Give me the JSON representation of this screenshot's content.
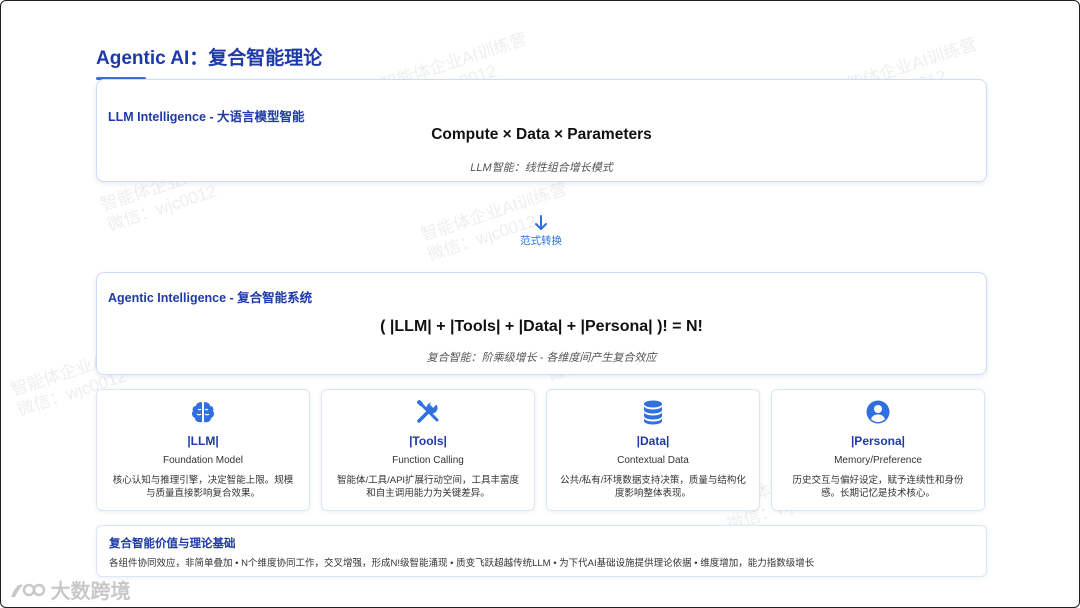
{
  "title": "Agentic AI：复合智能理论",
  "llm_card": {
    "heading": "LLM Intelligence - 大语言模型智能",
    "formula": "Compute × Data × Parameters",
    "caption": "LLM智能：线性组合增长模式"
  },
  "transition": {
    "label": "范式转换",
    "icon": "arrow-down-icon"
  },
  "agentic_card": {
    "heading": "Agentic Intelligence - 复合智能系统",
    "formula": "( |LLM| + |Tools| + |Data| + |Persona| )! = N!",
    "caption": "复合智能：阶乘级增长 - 各维度间产生复合效应"
  },
  "features": [
    {
      "icon": "brain-icon",
      "name": "|LLM|",
      "subtitle": "Foundation Model",
      "description": "核心认知与推理引擎，决定智能上限。规模与质量直接影响复合效果。"
    },
    {
      "icon": "tools-icon",
      "name": "|Tools|",
      "subtitle": "Function Calling",
      "description": "智能体/工具/API扩展行动空间，工具丰富度和自主调用能力为关键差异。"
    },
    {
      "icon": "database-icon",
      "name": "|Data|",
      "subtitle": "Contextual Data",
      "description": "公共/私有/环境数据支持决策，质量与结构化度影响整体表现。"
    },
    {
      "icon": "user-icon",
      "name": "|Persona|",
      "subtitle": "Memory/Preference",
      "description": "历史交互与偏好设定，赋予连续性和身份感。长期记忆是技术核心。"
    }
  ],
  "summary": {
    "title": "复合智能价值与理论基础",
    "text": "各组件协同效应，非简单叠加 • N个维度协同工作，交叉增强，形成N!级智能涌现 • 质变飞跃超越传统LLM • 为下代AI基础设施提供理论依据 • 维度增加，能力指数级增长"
  },
  "watermark": {
    "line1": "智能体企业AI训练营",
    "line2": "微信：wjc0012"
  },
  "logo": {
    "text": "大数跨境",
    "icon": "logo-icon"
  },
  "colors": {
    "accent": "#1f3aa8",
    "icon_blue": "#2f6fe0"
  }
}
